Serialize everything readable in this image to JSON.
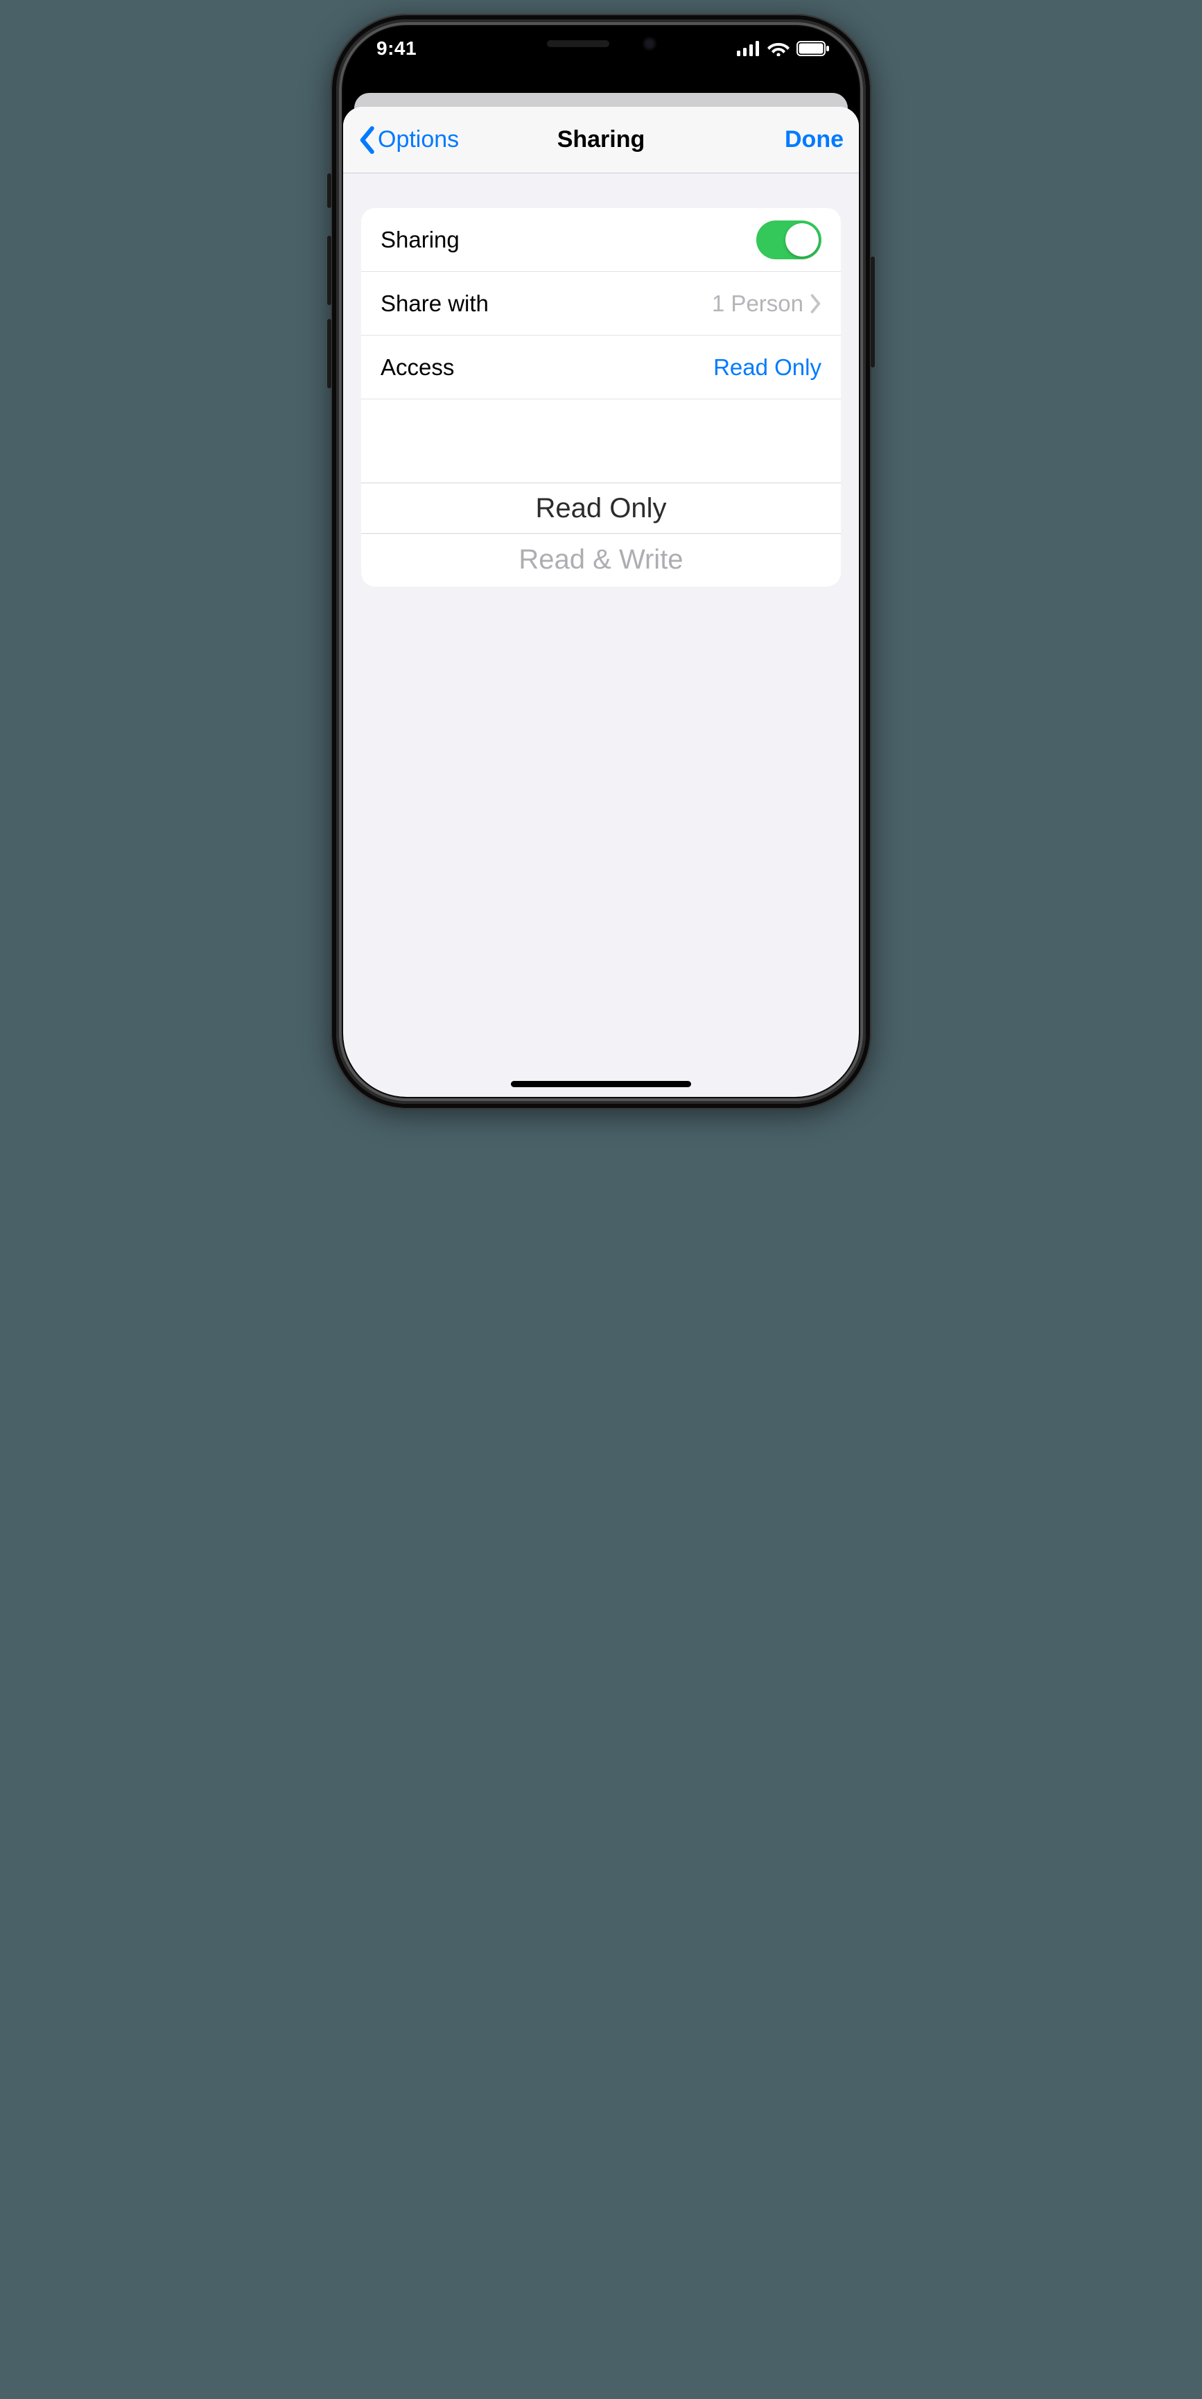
{
  "status": {
    "time": "9:41"
  },
  "nav": {
    "back_label": "Options",
    "title": "Sharing",
    "done_label": "Done"
  },
  "rows": {
    "sharing_label": "Sharing",
    "sharing_on": true,
    "share_with_label": "Share with",
    "share_with_value": "1 Person",
    "access_label": "Access",
    "access_value": "Read Only"
  },
  "picker": {
    "options": [
      "Read Only",
      "Read & Write"
    ],
    "selected_index": 0
  }
}
